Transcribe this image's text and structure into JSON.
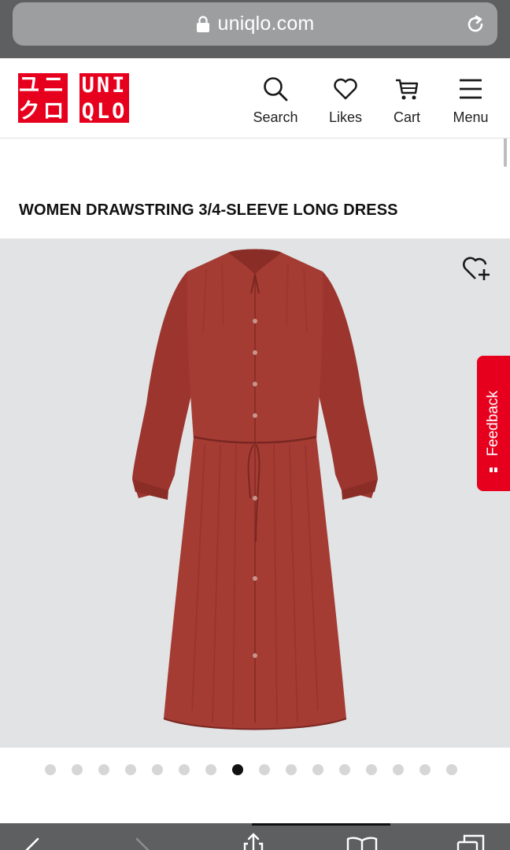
{
  "browser": {
    "url": "uniqlo.com",
    "bar_color": "#5e5f61"
  },
  "header": {
    "logo_katakana_top": "ユニ",
    "logo_katakana_bottom": "クロ",
    "logo_latin_top": "UNI",
    "logo_latin_bottom": "QLO",
    "brand_color": "#e6001e",
    "nav": [
      {
        "label": "Search",
        "icon": "search-icon"
      },
      {
        "label": "Likes",
        "icon": "heart-icon"
      },
      {
        "label": "Cart",
        "icon": "cart-icon"
      },
      {
        "label": "Menu",
        "icon": "hamburger-icon"
      }
    ]
  },
  "product": {
    "title": "WOMEN DRAWSTRING 3/4-SLEEVE LONG DRESS",
    "dress_color": "#a03a32",
    "image_background": "#e2e3e5"
  },
  "feedback": {
    "label": "Feedback"
  },
  "carousel": {
    "total_slides": 16,
    "active_index": 7
  },
  "toolbar": {
    "icons": [
      "back-icon",
      "forward-icon",
      "share-icon",
      "bookmarks-icon",
      "tabs-icon"
    ]
  }
}
